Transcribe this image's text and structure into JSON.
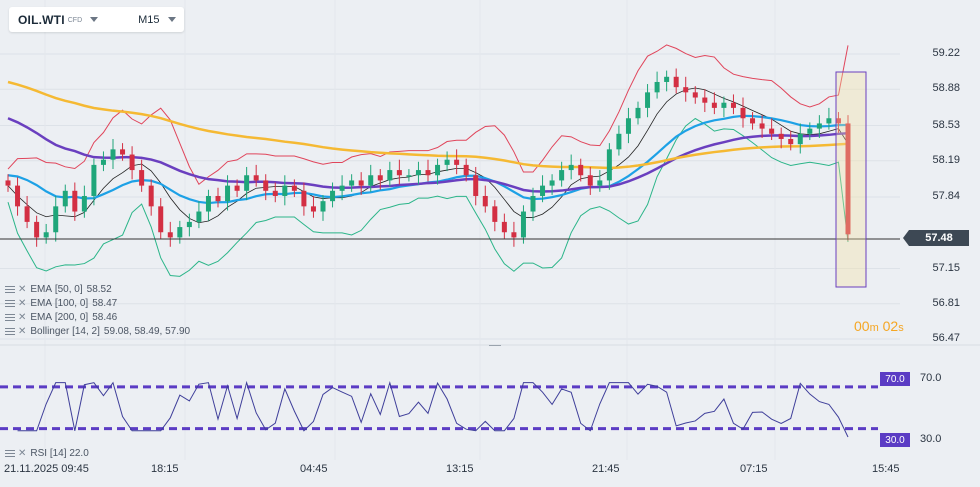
{
  "instrument": {
    "symbol": "OIL.WTI",
    "type": "CFD",
    "timeframe": "M15"
  },
  "price_axis": [
    {
      "label": "59.22",
      "value": 59.22
    },
    {
      "label": "58.88",
      "value": 58.88
    },
    {
      "label": "58.53",
      "value": 58.53
    },
    {
      "label": "58.19",
      "value": 58.19
    },
    {
      "label": "57.84",
      "value": 57.84
    },
    {
      "label": "57.15",
      "value": 57.15
    },
    {
      "label": "56.81",
      "value": 56.81
    },
    {
      "label": "56.47",
      "value": 56.47
    }
  ],
  "current_price": "57.48",
  "time_axis": [
    {
      "label": "21.11.2025  09:45"
    },
    {
      "label": "18:15"
    },
    {
      "label": "04:45"
    },
    {
      "label": "13:15"
    },
    {
      "label": "21:45"
    },
    {
      "label": "07:15"
    },
    {
      "label": "15:45"
    }
  ],
  "countdown": {
    "minutes": "00",
    "minutes_unit": "m",
    "seconds": "02",
    "seconds_unit": "s"
  },
  "indicators": [
    {
      "name": "EMA",
      "params": "[50, 0]",
      "values": "58.52"
    },
    {
      "name": "EMA",
      "params": "[100, 0]",
      "values": "58.47"
    },
    {
      "name": "EMA",
      "params": "[200, 0]",
      "values": "58.46"
    },
    {
      "name": "Bollinger",
      "params": "[14, 2]",
      "values": "59.08, 58.49, 57.90"
    }
  ],
  "rsi": {
    "name": "RSI",
    "params": "[14]",
    "value": "22.0",
    "upper_level": "70.0",
    "lower_level": "30.0",
    "axis_upper": "70.0",
    "axis_lower": "30.0"
  },
  "colors": {
    "bull": "#1fa67a",
    "bear": "#d32f43",
    "ema50": "#1da1e6",
    "ema100": "#6a3fbf",
    "ema200": "#f5b933",
    "bb_upper": "#e0455b",
    "bb_lower": "#2bb589",
    "bb_mid": "#222222",
    "rsi_line": "#3f3f9a",
    "rsi_level": "#5b3cc4"
  },
  "chart_data": {
    "type": "candlestick",
    "ylim": [
      56.47,
      59.22
    ],
    "closes": [
      57.95,
      57.75,
      57.6,
      57.45,
      57.5,
      57.75,
      57.9,
      57.7,
      57.85,
      58.15,
      58.2,
      58.3,
      58.25,
      58.1,
      57.95,
      57.75,
      57.5,
      57.45,
      57.55,
      57.6,
      57.7,
      57.85,
      57.8,
      57.95,
      57.9,
      58.05,
      58.0,
      57.9,
      57.85,
      57.95,
      57.9,
      57.75,
      57.7,
      57.8,
      57.9,
      57.95,
      58.0,
      57.95,
      58.05,
      58.0,
      58.1,
      58.05,
      58.05,
      58.1,
      58.05,
      58.15,
      58.2,
      58.15,
      58.05,
      57.85,
      57.75,
      57.6,
      57.5,
      57.45,
      57.7,
      57.85,
      57.95,
      58.0,
      58.1,
      58.15,
      58.05,
      57.95,
      58.0,
      58.3,
      58.45,
      58.6,
      58.7,
      58.85,
      58.95,
      59.0,
      58.9,
      58.85,
      58.8,
      58.75,
      58.7,
      58.75,
      58.7,
      58.6,
      58.55,
      58.5,
      58.45,
      58.4,
      58.35,
      58.45,
      58.5,
      58.55,
      58.6,
      58.55,
      57.48
    ]
  }
}
